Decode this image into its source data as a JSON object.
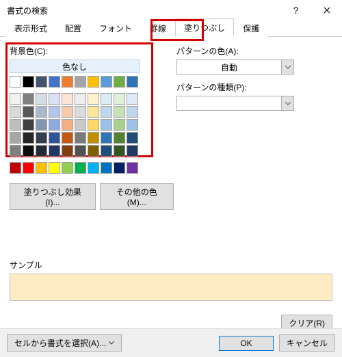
{
  "title": "書式の検索",
  "tabs": [
    "表示形式",
    "配置",
    "フォント",
    "罫線",
    "塗りつぶし",
    "保護"
  ],
  "active_tab_index": 4,
  "bg_label": "背景色(C):",
  "no_color": "色なし",
  "buttons": {
    "fill_effects": "塗りつぶし効果(I)...",
    "more_colors": "その他の色(M)..."
  },
  "pattern_color_label": "パターンの色(A):",
  "pattern_color_value": "自動",
  "pattern_type_label": "パターンの種類(P):",
  "pattern_type_value": "",
  "sample_label": "サンプル",
  "sample_color": "#ffecc5",
  "clear_btn": "クリア(R)",
  "footer": {
    "from_cell": "セルから書式を選択(A)...",
    "ok": "OK",
    "cancel": "キャンセル"
  },
  "theme_colors_row1": [
    "#ffffff",
    "#000000",
    "#44546a",
    "#4472c4",
    "#ed7d31",
    "#a5a5a5",
    "#ffc000",
    "#5b9bd5",
    "#70ad47",
    "#2e75b6"
  ],
  "theme_shades": [
    [
      "#f2f2f2",
      "#808080",
      "#d6dce5",
      "#d9e1f2",
      "#fce4d6",
      "#ededed",
      "#fff2cc",
      "#ddebf7",
      "#e2efda",
      "#deebf7"
    ],
    [
      "#d9d9d9",
      "#595959",
      "#acb9ca",
      "#b4c6e7",
      "#f8cbad",
      "#dbdbdb",
      "#ffe699",
      "#bdd7ee",
      "#c6e0b4",
      "#bdd7ee"
    ],
    [
      "#bfbfbf",
      "#404040",
      "#8497b0",
      "#8ea9db",
      "#f4b084",
      "#c9c9c9",
      "#ffd966",
      "#9bc2e6",
      "#a9d08e",
      "#9bc2e6"
    ],
    [
      "#a6a6a6",
      "#262626",
      "#333f4f",
      "#305496",
      "#c65911",
      "#7b7b7b",
      "#bf8f00",
      "#2f75b5",
      "#548235",
      "#1f4e78"
    ],
    [
      "#808080",
      "#0d0d0d",
      "#222b35",
      "#203764",
      "#833c0c",
      "#525252",
      "#806000",
      "#1f4e78",
      "#375623",
      "#1f3864"
    ]
  ],
  "standard_colors": [
    "#c00000",
    "#ff0000",
    "#ffc000",
    "#ffff00",
    "#92d050",
    "#00b050",
    "#00b0f0",
    "#0070c0",
    "#002060",
    "#7030a0"
  ]
}
